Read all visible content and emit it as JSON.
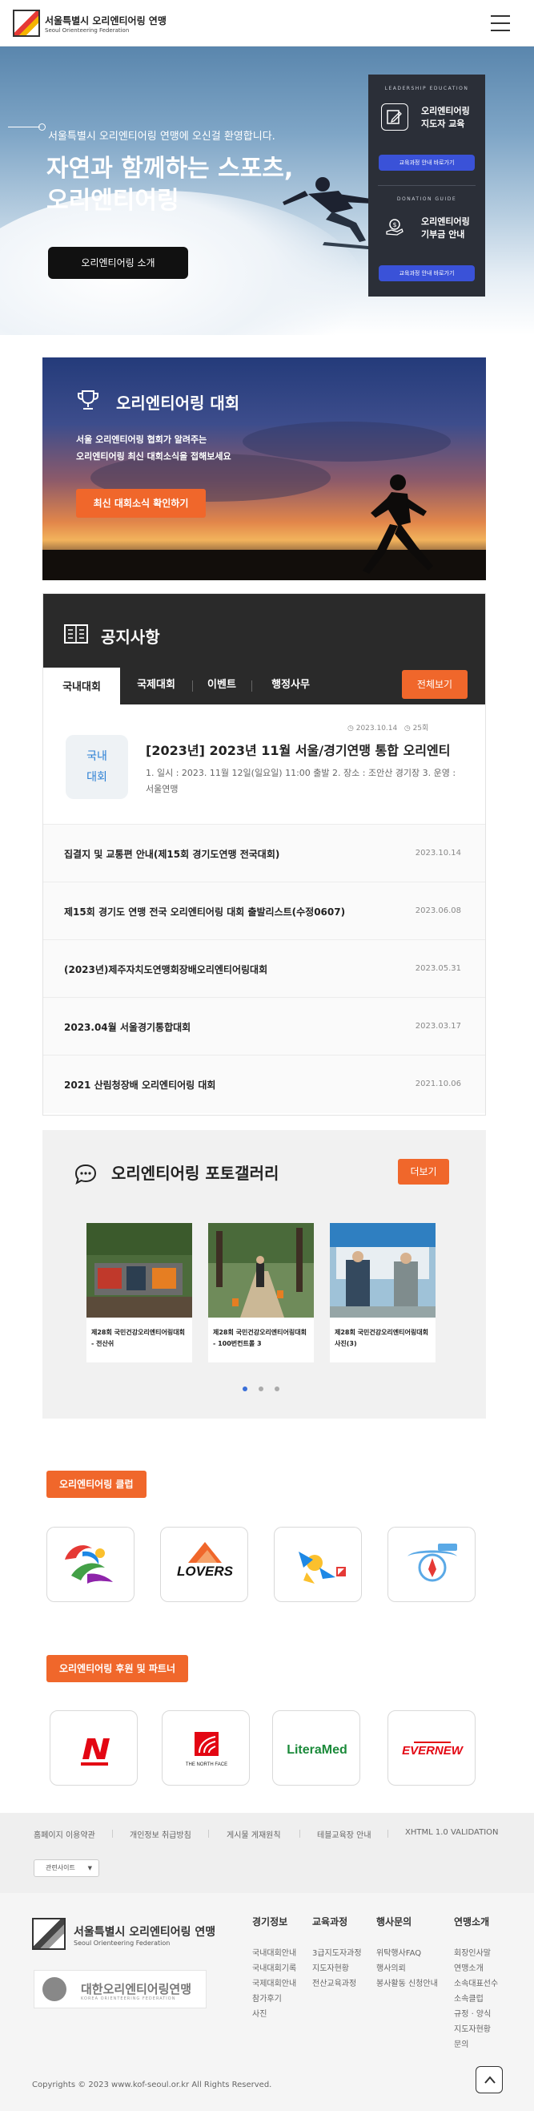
{
  "header": {
    "site_title": "서울특별시 오리엔티어링 연맹",
    "site_subtitle": "Seoul Orienteering Federation",
    "menu_icon": "hamburger-menu-icon"
  },
  "hero": {
    "welcome": "서울특별시 오리엔티어링 연맹에 오신걸 환영합니다.",
    "title_line1": "자연과 함께하는 스포츠,",
    "title_line2": "오리엔티어링",
    "intro_button": "오리엔티어링 소개"
  },
  "side_panel": {
    "education": {
      "caption": "LEADERSHIP EDUCATION",
      "title_line1": "오리엔티어링",
      "title_line2": "지도자 교육",
      "button": "교육과정 안내 바로가기",
      "icon": "edit-document-icon"
    },
    "donation": {
      "caption": "DONATION GUIDE",
      "title_line1": "오리엔티어링",
      "title_line2": "기부금 안내",
      "button": "교육과정 안내 바로가기",
      "icon": "donation-hand-icon"
    }
  },
  "competition": {
    "title": "오리엔티어링 대회",
    "desc_line1": "서울 오리엔티어링 협회가 알려주는",
    "desc_line2": "오리엔티어링 최신 대회소식을 접해보세요",
    "button": "최신 대회소식 확인하기",
    "icon": "trophy-icon"
  },
  "notice": {
    "title": "공지사항",
    "icon": "notice-board-icon",
    "tabs": [
      {
        "label": "국내대회"
      },
      {
        "label": "국제대회"
      },
      {
        "label": "이벤트"
      },
      {
        "label": "행정사무"
      }
    ],
    "more_button": "전체보기",
    "featured": {
      "category_line1": "국내",
      "category_line2": "대회",
      "date": "2023.10.14",
      "views": "25회",
      "title": "[2023년] 2023년 11월 서울/경기연맹 통합 오리엔티",
      "body": "1. 일시 : 2023. 11월 12일(일요일) 11:00 출발 2. 장소 : 조안산 경기장 3. 운영 : 서울연맹"
    },
    "items": [
      {
        "title": "집결지 및 교통편 안내(제15회 경기도연맹 전국대회)",
        "date": "2023.10.14"
      },
      {
        "title": "제15회 경기도 연맹 전국 오리엔티어링 대회 출발리스트(수정0607)",
        "date": "2023.06.08"
      },
      {
        "title": "(2023년)제주자치도연맹회장배오리엔티어링대회",
        "date": "2023.05.31"
      },
      {
        "title": "2023.04월 서울경기통합대회",
        "date": "2023.03.17"
      },
      {
        "title": "2021 산림청장배 오리엔티어링 대회",
        "date": "2021.10.06"
      }
    ]
  },
  "gallery": {
    "title": "오리엔티어링 포토갤러리",
    "icon": "chat-bubble-icon",
    "more_button": "더보기",
    "cards": [
      {
        "caption": "제28회 국민건강오리엔티어링대회 - 전산쉬"
      },
      {
        "caption": "제28회 국민건강오리엔티어링대회 - 100번컨트롤 3"
      },
      {
        "caption": "제28회 국민건강오리엔티어링대회 사진(3)"
      }
    ],
    "page_count": 3,
    "active_page": 1
  },
  "clubs": {
    "label": "오리엔티어링 클럽",
    "logos": [
      {
        "name": "club-logo-1"
      },
      {
        "name": "club-logo-lovers",
        "text": "LOVERS"
      },
      {
        "name": "club-logo-3"
      },
      {
        "name": "club-logo-4"
      }
    ]
  },
  "partners": {
    "label": "오리엔티어링 후원 및 파트너",
    "logos": [
      {
        "name": "partner-nepa"
      },
      {
        "name": "partner-north-face",
        "text": "THE NORTH FACE"
      },
      {
        "name": "partner-literamed",
        "text": "LiteraMed"
      },
      {
        "name": "partner-evernew",
        "text": "EVERNEW"
      }
    ]
  },
  "footer": {
    "links": [
      "홈페이지 이용약관",
      "개인정보 취급방침",
      "게시물 게재원칙",
      "테블교육장 안내",
      "XHTML 1.0 VALIDATION"
    ],
    "related_sites": "관련사이트",
    "org_title": "서울특별시 오리엔티어링 연맹",
    "org_subtitle": "Seoul Orienteering Federation",
    "kof_title": "대한오리엔티어링연맹",
    "kof_subtitle": "KOREA ORIENTEERING FEDERATION",
    "columns": [
      {
        "heading": "경기정보",
        "items": [
          "국내대회안내",
          "국내대회기록",
          "국제대회안내",
          "참가후기",
          "사진"
        ]
      },
      {
        "heading": "교육과정",
        "items": [
          "3급지도자과정",
          "지도자현황",
          "전산교육과정"
        ]
      },
      {
        "heading": "행사문의",
        "items": [
          "위탁행사FAQ",
          "행사의뢰",
          "봉사활동 신청안내"
        ]
      },
      {
        "heading": "연맹소개",
        "items": [
          "회장인사말",
          "연맹소개",
          "소속대표선수",
          "소속클럽",
          "규정 · 양식",
          "지도자현황",
          "문의"
        ]
      }
    ],
    "copyright": "Copyrights © 2023 www.kof-seoul.or.kr All Rights Reserved.",
    "top_button_icon": "arrow-up-icon"
  }
}
